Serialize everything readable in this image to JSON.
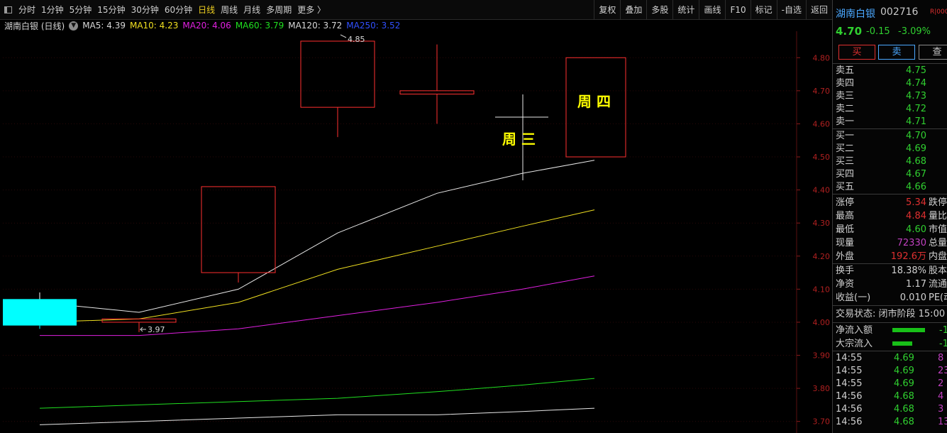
{
  "toolbar": {
    "periods": [
      "分时",
      "1分钟",
      "5分钟",
      "15分钟",
      "30分钟",
      "60分钟",
      "日线",
      "周线",
      "月线",
      "多周期",
      "更多 〉"
    ],
    "active_period": "日线",
    "tools": [
      "复权",
      "叠加",
      "多股",
      "统计",
      "画线",
      "F10",
      "标记",
      "-自选",
      "返回"
    ]
  },
  "legend": {
    "stock_label": "湖南白银 (日线)",
    "ma": [
      {
        "label": "MA5: 4.39",
        "color": "#d8d8d8"
      },
      {
        "label": "MA10: 4.23",
        "color": "#f0e020"
      },
      {
        "label": "MA20: 4.06",
        "color": "#e020e0"
      },
      {
        "label": "MA60: 3.79",
        "color": "#20e020"
      },
      {
        "label": "MA120: 3.72",
        "color": "#d8d8d8"
      },
      {
        "label": "MA250: 3.52",
        "color": "#3050ff"
      }
    ],
    "controls": "◇ ◧"
  },
  "chart_data": {
    "type": "candlestick",
    "y_ticks": [
      "4.80",
      "4.70",
      "4.60",
      "4.50",
      "4.40",
      "4.30",
      "4.20",
      "4.10",
      "4.00",
      "3.90",
      "3.80",
      "3.70"
    ],
    "ylim": [
      3.665,
      4.88
    ],
    "candles": [
      {
        "open": 4.07,
        "close": 3.99,
        "high": 4.09,
        "low": 3.98,
        "color": "cyan"
      },
      {
        "open": 4.01,
        "close": 4.0,
        "high": 4.01,
        "low": 3.97,
        "color": "red"
      },
      {
        "open": 4.15,
        "close": 4.41,
        "high": 4.41,
        "low": 4.12,
        "color": "red"
      },
      {
        "open": 4.65,
        "close": 4.85,
        "high": 4.85,
        "low": 4.56,
        "color": "red"
      },
      {
        "open": 4.69,
        "close": 4.7,
        "high": 4.84,
        "low": 4.6,
        "color": "red"
      },
      {
        "open": 4.5,
        "close": 4.8,
        "high": 4.8,
        "low": 4.5,
        "color": "red"
      }
    ],
    "annotations": [
      {
        "text": "4.85"
      },
      {
        "text": "3.97"
      },
      {
        "text": "周 三"
      },
      {
        "text": "周 四"
      }
    ],
    "ma_lines": [
      {
        "name": "MA5",
        "color": "#e8e8e8",
        "values": [
          4.06,
          4.03,
          4.1,
          4.27,
          4.39,
          4.45,
          4.49
        ]
      },
      {
        "name": "MA10",
        "color": "#f0e020",
        "values": [
          4.0,
          4.01,
          4.06,
          4.16,
          4.23,
          4.29,
          4.34
        ]
      },
      {
        "name": "MA20",
        "color": "#e020e0",
        "values": [
          3.96,
          3.96,
          3.98,
          4.02,
          4.06,
          4.1,
          4.14
        ]
      },
      {
        "name": "MA60",
        "color": "#20e020",
        "values": [
          3.74,
          3.75,
          3.76,
          3.77,
          3.79,
          3.81,
          3.83
        ]
      },
      {
        "name": "MA120",
        "color": "#e8e8e8",
        "values": [
          3.69,
          3.7,
          3.71,
          3.72,
          3.72,
          3.73,
          3.74
        ]
      }
    ]
  },
  "quote": {
    "name": "湖南白银",
    "code": "002716",
    "badge": "R|000",
    "price": "4.70",
    "change": "-0.15",
    "change_pct": "-3.09%",
    "buttons": {
      "buy": "买",
      "sell": "卖",
      "more": "查"
    }
  },
  "order_book": {
    "asks": [
      {
        "label": "卖五",
        "price": "4.75"
      },
      {
        "label": "卖四",
        "price": "4.74"
      },
      {
        "label": "卖三",
        "price": "4.73"
      },
      {
        "label": "卖二",
        "price": "4.72"
      },
      {
        "label": "卖一",
        "price": "4.71"
      }
    ],
    "bids": [
      {
        "label": "买一",
        "price": "4.70"
      },
      {
        "label": "买二",
        "price": "4.69"
      },
      {
        "label": "买三",
        "price": "4.68"
      },
      {
        "label": "买四",
        "price": "4.67"
      },
      {
        "label": "买五",
        "price": "4.66"
      }
    ]
  },
  "stats": [
    {
      "l1": "涨停",
      "v1": "5.34",
      "c1": "#e03030",
      "l2": "跌停"
    },
    {
      "l1": "最高",
      "v1": "4.84",
      "c1": "#e03030",
      "l2": "量比"
    },
    {
      "l1": "最低",
      "v1": "4.60",
      "c1": "#30d030",
      "l2": "市值"
    },
    {
      "l1": "现量",
      "v1": "72330",
      "c1": "#c040c0",
      "l2": "总量"
    },
    {
      "l1": "外盘",
      "v1": "192.6万",
      "c1": "#e03030",
      "l2": "内盘"
    },
    {
      "l1": "换手",
      "v1": "18.38%",
      "c1": "#d0d0d0",
      "l2": "股本"
    },
    {
      "l1": "净资",
      "v1": "1.17",
      "c1": "#d0d0d0",
      "l2": "流通"
    },
    {
      "l1": "收益(一)",
      "v1": "0.010",
      "c1": "#d0d0d0",
      "l2": "PE(动)"
    }
  ],
  "trade_status": "交易状态: 闭市阶段 15:00",
  "flows": [
    {
      "label": "净流入额",
      "bar": 0.46,
      "value": "-1"
    },
    {
      "label": "大宗流入",
      "bar": 0.28,
      "value": "-1"
    }
  ],
  "ticks": [
    {
      "time": "14:55",
      "price": "4.69",
      "vol": "8"
    },
    {
      "time": "14:55",
      "price": "4.69",
      "vol": "23"
    },
    {
      "time": "14:55",
      "price": "4.69",
      "vol": "2"
    },
    {
      "time": "14:56",
      "price": "4.68",
      "vol": "4"
    },
    {
      "time": "14:56",
      "price": "4.68",
      "vol": "3"
    },
    {
      "time": "14:56",
      "price": "4.68",
      "vol": "13"
    }
  ]
}
